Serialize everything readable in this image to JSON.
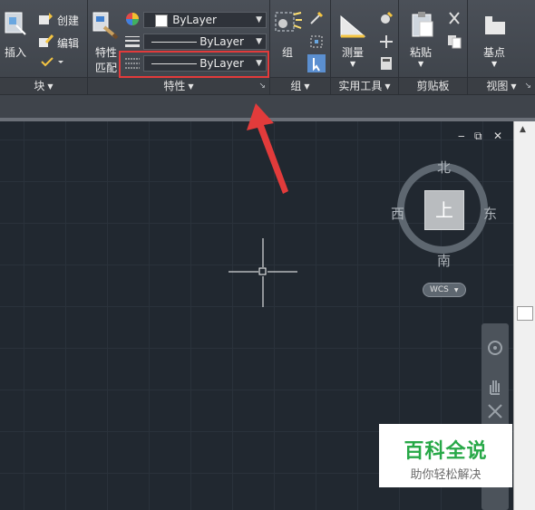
{
  "ribbon": {
    "block_panel": {
      "insert_label": "插入",
      "create_label": "创建",
      "edit_label": "编辑",
      "title": "块"
    },
    "properties_panel": {
      "match_label_line1": "特性",
      "match_label_line2": "匹配",
      "color_value": "ByLayer",
      "lineweight_value": "ByLayer",
      "linetype_value": "ByLayer",
      "title": "特性"
    },
    "group_panel": {
      "group_label": "组",
      "title": "组"
    },
    "utilities_panel": {
      "measure_label": "测量",
      "title": "实用工具"
    },
    "clipboard_panel": {
      "paste_label": "粘贴",
      "title": "剪贴板"
    },
    "view_panel": {
      "basepoint_label": "基点",
      "title": "视图"
    }
  },
  "viewcube": {
    "north": "北",
    "south": "南",
    "east": "东",
    "west": "西",
    "top": "上",
    "wcs": "WCS"
  },
  "window_controls": {
    "minimize": "‒",
    "restore": "⧉",
    "close": "✕"
  },
  "watermark": {
    "title": "百科全说",
    "subtitle": "助你轻松解决"
  },
  "colors": {
    "highlight": "#e23b3b",
    "arrow": "#e23b3b",
    "watermark_green": "#27a847",
    "canvas": "#212830"
  }
}
